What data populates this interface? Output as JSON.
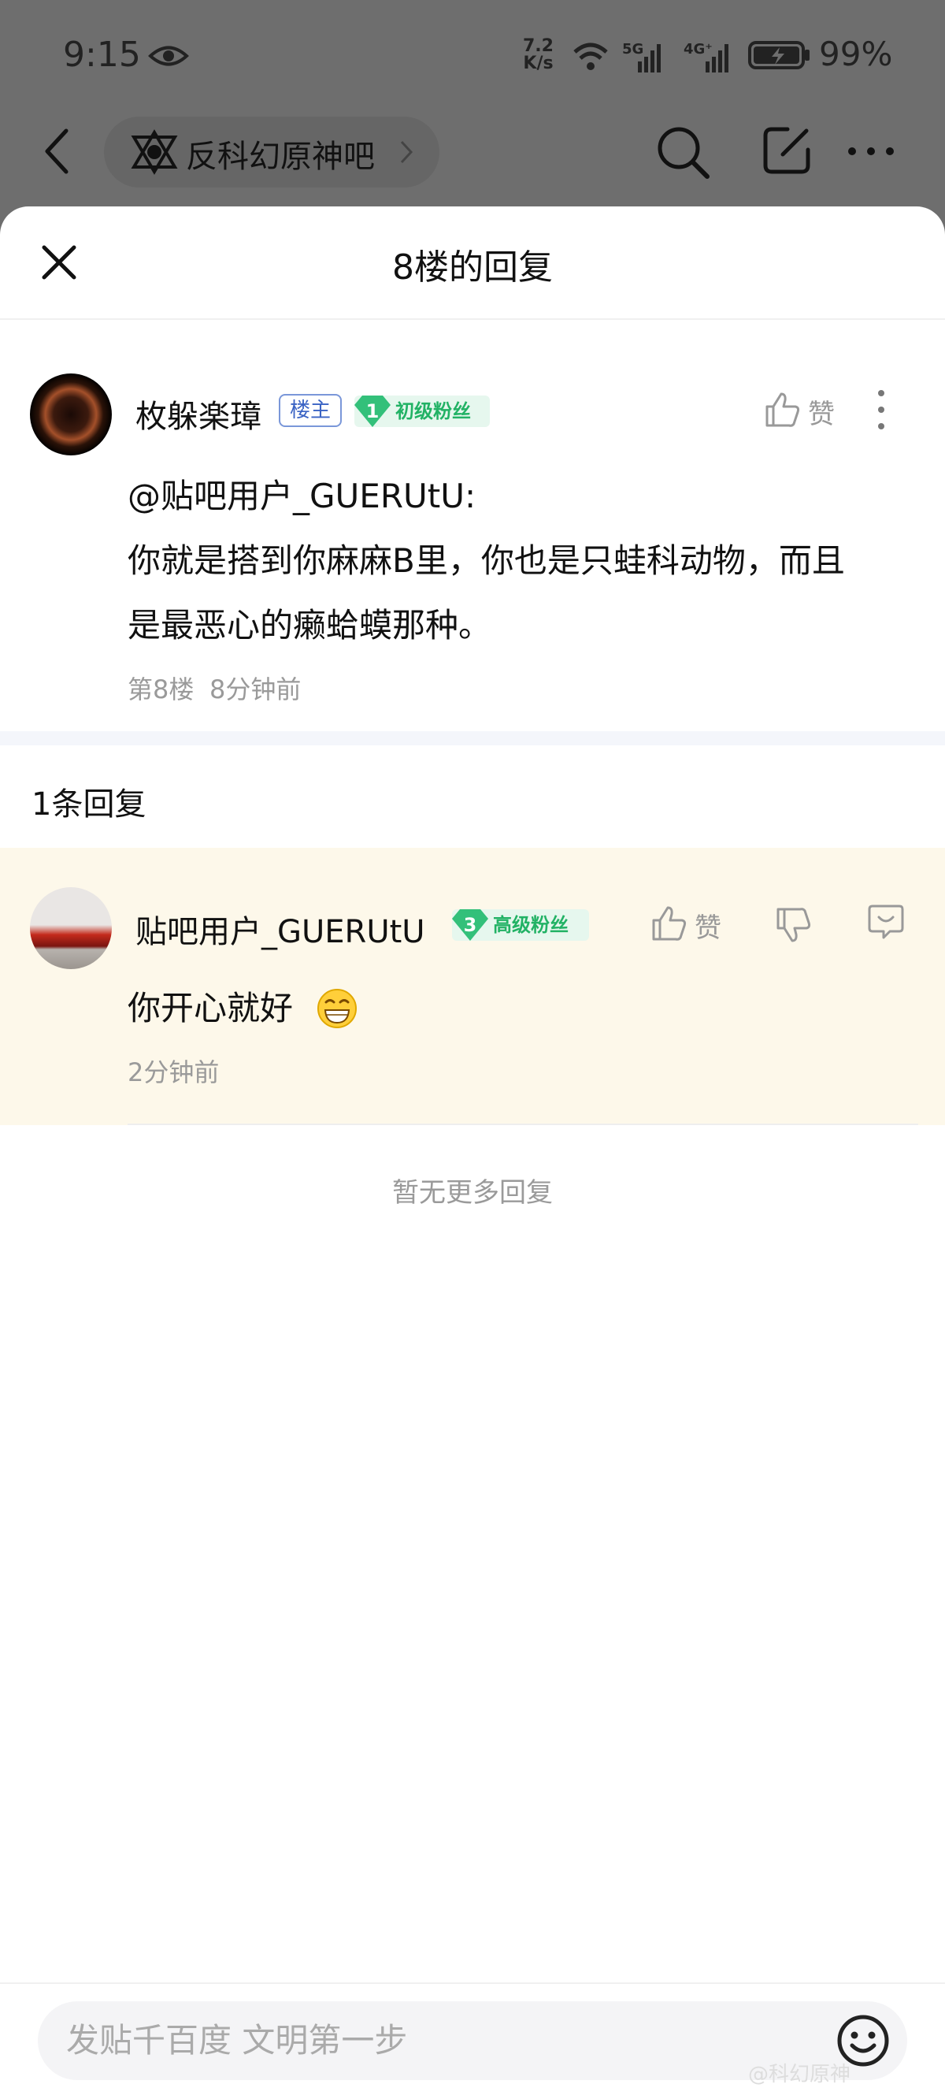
{
  "status_bar": {
    "time": "9:15",
    "net_speed_value": "7.2",
    "net_speed_unit": "K/s",
    "signal_5g": "5G",
    "signal_4g": "4G⁺",
    "battery": "99%"
  },
  "nav": {
    "forum_name": "反科幻原神吧"
  },
  "sheet": {
    "title": "8楼的回复"
  },
  "post": {
    "username": "枚躲楽璋",
    "owner_badge": "楼主",
    "fan_level": "1",
    "fan_label": "初级粉丝",
    "like_label": "赞",
    "mention": "@贴吧用户_GUERUtU:",
    "line1": "你就是搭到你麻麻B里，你也是只蛙科动物，而且",
    "line2": "是最恶心的癞蛤蟆那种。",
    "floor": "第8楼",
    "time": "8分钟前"
  },
  "replies_header": "1条回复",
  "reply": {
    "username": "贴吧用户_GUERUtU",
    "fan_level": "3",
    "fan_label": "高级粉丝",
    "like_label": "赞",
    "text": "你开心就好",
    "time": "2分钟前"
  },
  "no_more": "暂无更多回复",
  "input": {
    "placeholder": "发贴千百度 文明第一步"
  },
  "watermark": "@科幻原神"
}
